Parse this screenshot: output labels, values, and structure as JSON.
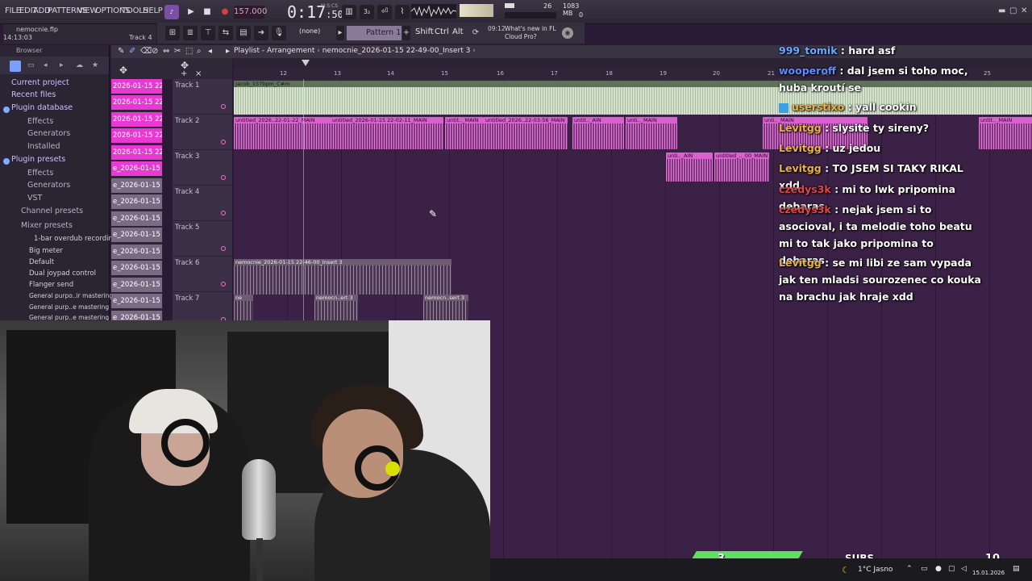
{
  "menu": [
    "FILE",
    "EDIT",
    "ADD",
    "PATTERNS",
    "VIEW",
    "OPTIONS",
    "TOOLS",
    "HELP"
  ],
  "project": {
    "file": "nemocnie.flp",
    "time": "14:13:03",
    "track_hint": "Track 4"
  },
  "transport": {
    "tempo": "157.000",
    "time_main": "0:17",
    "time_small": ":50",
    "time_label": "M:S:CS"
  },
  "cpu": {
    "polyphony": "26",
    "memory": "1083 MB",
    "cpu": "0"
  },
  "toolbar": {
    "none_label": "(none)",
    "pattern": "Pattern 1",
    "shift": "Shift",
    "ctrl": "Ctrl",
    "alt": "Alt",
    "news_time": "09:12",
    "news_text": "What's new in FL Cloud Pro?"
  },
  "browser": {
    "title": "Browser",
    "items": [
      {
        "label": "Current project",
        "kind": "cat"
      },
      {
        "label": "Recent files",
        "kind": "cat"
      },
      {
        "label": "Plugin database",
        "kind": "cat"
      },
      {
        "label": "Effects",
        "kind": "sub"
      },
      {
        "label": "Generators",
        "kind": "sub"
      },
      {
        "label": "Installed",
        "kind": "sub"
      },
      {
        "label": "Plugin presets",
        "kind": "cat"
      },
      {
        "label": "Effects",
        "kind": "sub"
      },
      {
        "label": "Generators",
        "kind": "sub"
      },
      {
        "label": "VST",
        "kind": "sub"
      },
      {
        "label": "Channel presets",
        "kind": "sub"
      },
      {
        "label": "Mixer presets",
        "kind": "sub"
      },
      {
        "label": "1-bar overdub recording",
        "kind": "leaf"
      },
      {
        "label": "Big meter",
        "kind": "leaf"
      },
      {
        "label": "Default",
        "kind": "leaf"
      },
      {
        "label": "Dual joypad control",
        "kind": "leaf"
      },
      {
        "label": "Flanger send",
        "kind": "leaf"
      },
      {
        "label": "General purpo..ir mastering",
        "kind": "leaf"
      },
      {
        "label": "General purp..e mastering 2",
        "kind": "leaf"
      },
      {
        "label": "General purp..e mastering 3",
        "kind": "leaf"
      }
    ]
  },
  "playlist": {
    "breadcrumb": "Playlist - Arrangement",
    "arrangement": "nemocnie_2026-01-15 22-49-00_Insert 3",
    "ruler": [
      "12",
      "13",
      "14",
      "15",
      "16",
      "17",
      "18",
      "19",
      "20",
      "21",
      "22",
      "23",
      "24",
      "25"
    ],
    "patterns": [
      "2026-01-15 22-",
      "2026-01-15 22-",
      "2026-01-15 22-",
      "2026-01-15 22-",
      "2026-01-15 22-",
      "e_2026-01-15 2",
      "e_2026-01-15 2",
      "e_2026-01-15 2",
      "e_2026-01-15 2",
      "e_2026-01-15 2",
      "e_2026-01-15 2",
      "e_2026-01-15 2",
      "e_2026-01-15 2",
      "e_2026-01-15 2",
      "e_2026-01-15 2"
    ],
    "tracks": [
      "Track 1",
      "Track 2",
      "Track 3",
      "Track 4",
      "Track 5",
      "Track 6",
      "Track 7"
    ],
    "clips": {
      "t1": "Jacob_157bpm_C#m",
      "t2a": "untitled_2026..22-01-22_MAIN",
      "t2b": "untitled_2026-01-15 22-02-11_MAIN",
      "t2c": "untit.._MAIN",
      "t2d": "untitled_2026..22-03-56_MAIN",
      "t2e": "untit.._AIN",
      "t2f": "unti.._MAIN",
      "t2g": "unti.._MAIN",
      "t2h": "untit.._MAIN",
      "t3a": "unti.._AIN",
      "t3b": "untitled_.._00_MAIN",
      "t6": "nemocnie_2026-01-15 22-46-00_Insert 3",
      "t7a": "ne",
      "t7b": "nemocn..ert 3",
      "t7c": "nemocn..sert 3"
    }
  },
  "chat": [
    {
      "user": "999_tomik",
      "color": "#6ea8ff",
      "text": "hard asf"
    },
    {
      "user": "wooperoff",
      "color": "#5c8cff",
      "text": "dal jsem si toho moc, huba kroutí se"
    },
    {
      "user": "userstixo",
      "color": "#e8b34a",
      "text": "yall cookin"
    },
    {
      "user": "Levitgg",
      "color": "#e8b34a",
      "text": "slysite ty sireny?"
    },
    {
      "user": "Levitgg",
      "color": "#e8b34a",
      "text": "uz jedou"
    },
    {
      "user": "Levitgg",
      "color": "#e8b34a",
      "text": "TO JSEM SI TAKY RIKAL xdd"
    },
    {
      "user": "czedys3k",
      "color": "#e0454a",
      "text": "mi to lwk pripomina debaras"
    },
    {
      "user": "czedys3k",
      "color": "#e0454a",
      "text": "nejak jsem si to asocioval, i ta melodie toho beatu mi to tak jako pripomina to debaras"
    },
    {
      "user": "Levitgg",
      "color": "#e8b34a",
      "text": "se mi libi ze sam vypada jak ten mladsi sourozenec co kouka na brachu jak hraje xdd"
    }
  ],
  "overlay": {
    "subs_count": "3",
    "subs_label": "SUBS",
    "subs_goal": "10"
  },
  "taskbar": {
    "weather": "1°C Jasno",
    "date": "15.01.2026"
  },
  "colors": {
    "accent": "#ff5fd2",
    "clip_pink": "#d960cf",
    "clip_green": "#9fb59a",
    "subs_bar": "#5fe061"
  }
}
